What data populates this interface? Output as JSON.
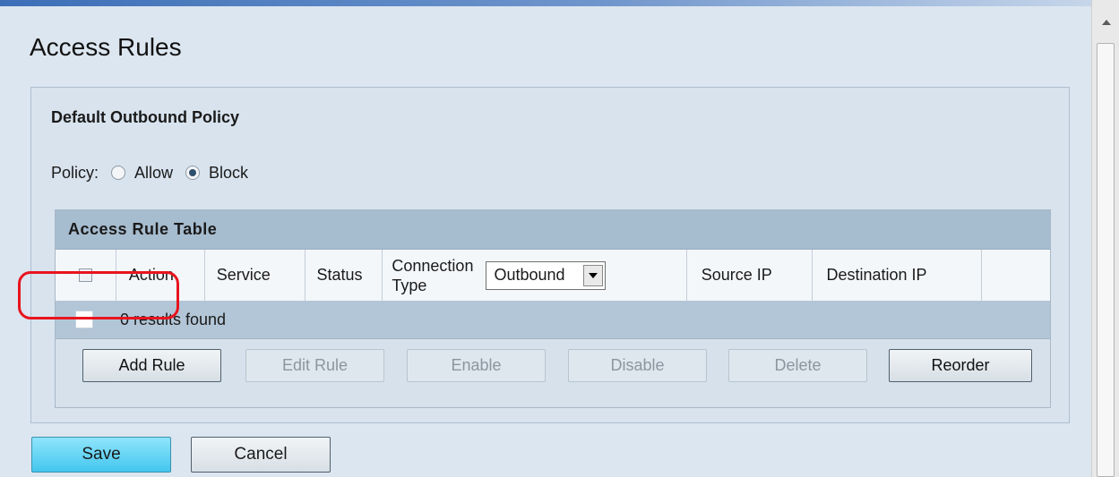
{
  "page": {
    "title": "Access Rules"
  },
  "outbound_policy": {
    "heading": "Default Outbound Policy",
    "label": "Policy:",
    "options": [
      {
        "label": "Allow",
        "checked": false
      },
      {
        "label": "Block",
        "checked": true
      }
    ]
  },
  "table": {
    "title": "Access Rule Table",
    "columns": {
      "action": "Action",
      "service": "Service",
      "status": "Status",
      "connection_type_line1": "Connection",
      "connection_type_line2": "Type",
      "connection_type_selected": "Outbound",
      "source_ip": "Source IP",
      "destination_ip": "Destination IP"
    },
    "results_text": "0 results found"
  },
  "table_buttons": {
    "add_rule": "Add Rule",
    "edit_rule": "Edit Rule",
    "enable": "Enable",
    "disable": "Disable",
    "delete": "Delete",
    "reorder": "Reorder"
  },
  "footer": {
    "save": "Save",
    "cancel": "Cancel"
  },
  "colors": {
    "highlight": "#e8141e",
    "save_button": "#43c6ee",
    "table_header": "#a6bccf"
  }
}
